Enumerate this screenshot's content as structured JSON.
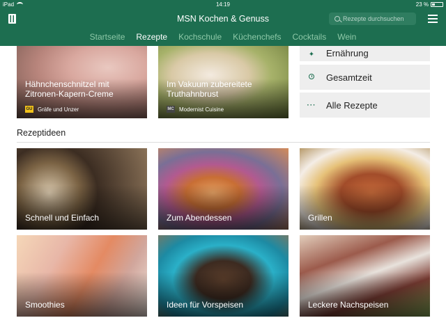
{
  "status_bar": {
    "device": "iPad",
    "time": "14:19",
    "battery": "23 %",
    "battery_level": 0.23
  },
  "header": {
    "title": "MSN Kochen & Genuss",
    "search_placeholder": "Rezepte durchsuchen"
  },
  "nav": {
    "items": [
      {
        "label": "Startseite",
        "active": false
      },
      {
        "label": "Rezepte",
        "active": true
      },
      {
        "label": "Kochschule",
        "active": false
      },
      {
        "label": "Küchenchefs",
        "active": false
      },
      {
        "label": "Cocktails",
        "active": false
      },
      {
        "label": "Wein",
        "active": false
      }
    ]
  },
  "featured": [
    {
      "title": "Hähnchenschnitzel mit Zitronen-Kapern-Creme",
      "source": "Gräfe und Unzer",
      "badge": "GU",
      "icon": "chicken-photo"
    },
    {
      "title": "Im Vakuum zubereitete Truthahnbrust",
      "source": "Modernist Cuisine",
      "badge": "MC",
      "icon": "turkey-photo"
    }
  ],
  "side_menu": [
    {
      "label": "Ernährung",
      "icon": "pin-icon"
    },
    {
      "label": "Gesamtzeit",
      "icon": "clock-icon"
    },
    {
      "label": "Alle Rezepte",
      "icon": "dots-icon"
    }
  ],
  "section": {
    "title": "Rezeptideen"
  },
  "ideas": [
    {
      "label": "Schnell und Einfach",
      "icon": "mushroom-photo"
    },
    {
      "label": "Zum Abendessen",
      "icon": "fish-photo"
    },
    {
      "label": "Grillen",
      "icon": "grill-photo"
    },
    {
      "label": "Smoothies",
      "icon": "smoothie-photo"
    },
    {
      "label": "Ideen für Vorspeisen",
      "icon": "skewer-photo"
    },
    {
      "label": "Leckere Nachspeisen",
      "icon": "dessert-photo"
    }
  ],
  "colors": {
    "brand": "#1d6e50",
    "nav_inactive": "#8ec9a8",
    "nav_active": "#ffffff"
  }
}
